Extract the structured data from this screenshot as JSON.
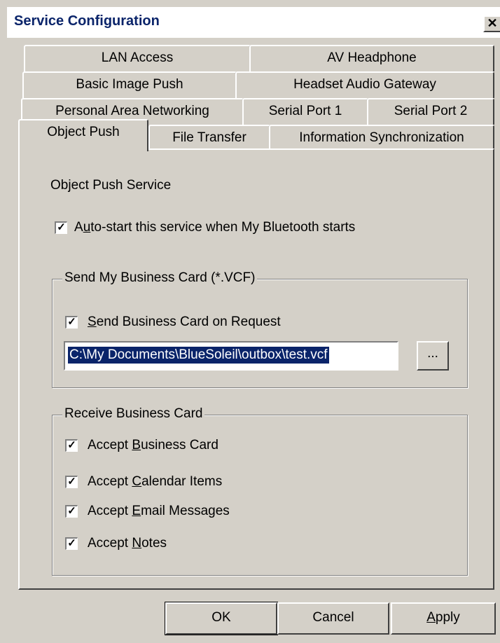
{
  "window": {
    "title": "Service Configuration",
    "close_glyph": "✕"
  },
  "tabs": {
    "row1": [
      "LAN Access",
      "AV Headphone"
    ],
    "row2": [
      "Basic Image Push",
      "Headset Audio Gateway"
    ],
    "row3": [
      "Personal Area Networking",
      "Serial Port 1",
      "Serial Port 2"
    ],
    "row4": [
      "Object Push",
      "File Transfer",
      "Information Synchronization"
    ],
    "active": "Object Push"
  },
  "panel": {
    "heading": "Object Push Service",
    "autostart": {
      "pre": "A",
      "mn": "u",
      "post": "to-start this service when My Bluetooth starts",
      "checked": true
    }
  },
  "send_group": {
    "legend": "Send My Business Card (*.VCF)",
    "send_on_request": {
      "pre": "",
      "mn": "S",
      "post": "end Business Card on Request",
      "checked": true
    },
    "path_value": "C:\\My Documents\\BlueSoleil\\outbox\\test.vcf",
    "browse_label": "..."
  },
  "receive_group": {
    "legend": "Receive Business Card",
    "items": [
      {
        "pre": "Accept ",
        "mn": "B",
        "post": "usiness Card",
        "checked": true
      },
      {
        "pre": "Accept ",
        "mn": "C",
        "post": "alendar Items",
        "checked": true
      },
      {
        "pre": "Accept ",
        "mn": "E",
        "post": "mail Messages",
        "checked": true
      },
      {
        "pre": "Accept ",
        "mn": "N",
        "post": "otes",
        "checked": true
      }
    ]
  },
  "buttons": {
    "ok": "OK",
    "cancel": "Cancel",
    "apply_mn": "A",
    "apply_rest": "pply"
  },
  "colors": {
    "face": "#d4d0c8",
    "title_text": "#0a246a",
    "selection": "#0a246a"
  }
}
